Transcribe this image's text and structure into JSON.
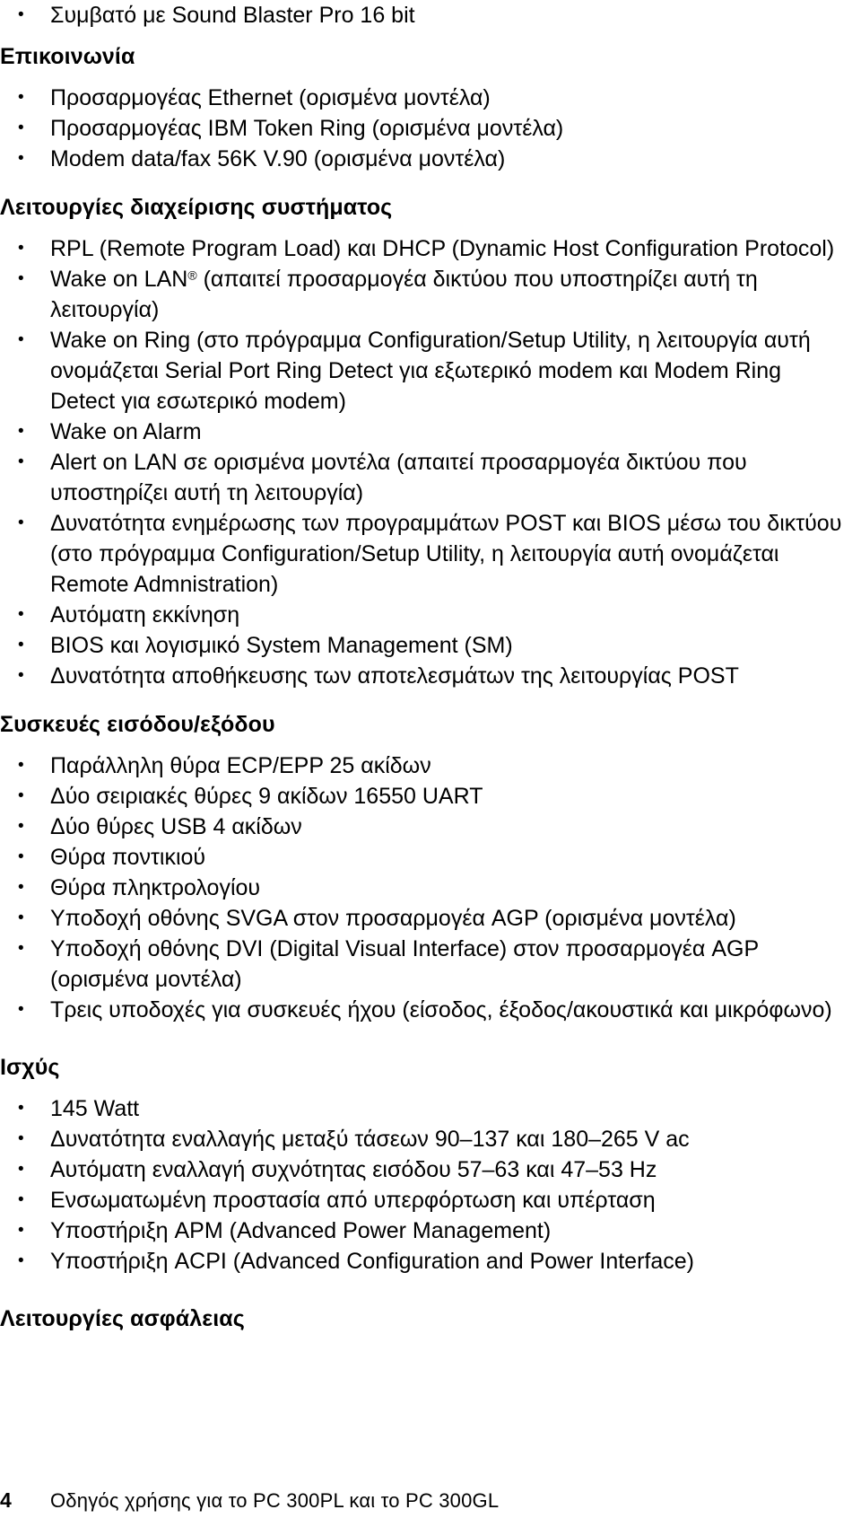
{
  "document": {
    "language": "el",
    "page_number": "4",
    "footer_text": "Οδηγός χρήσης για το PC 300PL και το PC 300GL"
  },
  "top_orphan_bullet": "Συμβατό με Sound Blaster Pro 16 bit",
  "sections": [
    {
      "id": "communications",
      "heading": "Επικοινωνία",
      "bullets": [
        "Προσαρμογέας Ethernet (ορισμένα μοντέλα)",
        "Προσαρμογέας IBM Token Ring (ορισμένα μοντέλα)",
        "Modem data/fax 56K V.90 (ορισμένα μοντέλα)"
      ]
    },
    {
      "id": "system-management",
      "heading": "Λειτουργίες διαχείρισης συστήματος",
      "bullets": [
        "RPL (Remote Program Load) και DHCP (Dynamic Host Configuration Protocol)",
        "Wake on LAN® (απαιτεί προσαρμογέα δικτύου που υποστηρίζει αυτή τη λειτουργία)",
        "Wake on Ring (στο πρόγραμμα Configuration/Setup Utility, η λειτουργία αυτή ονομάζεται Serial Port Ring Detect για εξωτερικό modem και Modem Ring Detect για εσωτερικό modem)",
        "Wake on Alarm",
        "Alert on LAN σε ορισμένα μοντέλα (απαιτεί προσαρμογέα δικτύου που υποστηρίζει αυτή τη λειτουργία)",
        "Δυνατότητα ενημέρωσης των προγραμμάτων POST και BIOS μέσω του δικτύου (στο πρόγραμμα Configuration/Setup Utility, η λειτουργία αυτή ονομάζεται Remote Admnistration)",
        "Αυτόματη εκκίνηση",
        "BIOS και λογισμικό System Management (SM)",
        "Δυνατότητα αποθήκευσης των αποτελεσμάτων της λειτουργίας POST"
      ]
    },
    {
      "id": "io-devices",
      "heading": "Συσκευές εισόδου/εξόδου",
      "bullets": [
        "Παράλληλη θύρα ECP/EPP 25 ακίδων",
        "Δύο σειριακές θύρες 9 ακίδων 16550 UART",
        "Δύο θύρες USB 4 ακίδων",
        "Θύρα ποντικιού",
        "Θύρα πληκτρολογίου",
        "Υποδοχή οθόνης SVGA στον προσαρμογέα AGP (ορισμένα μοντέλα)",
        "Υποδοχή οθόνης DVI (Digital Visual Interface) στον προσαρμογέα AGP (ορισμένα μοντέλα)",
        "Τρεις υποδοχές για συσκευές ήχου (είσοδος, έξοδος/ακουστικά και μικρόφωνο)"
      ]
    },
    {
      "id": "power",
      "heading": "Ισχύς",
      "bullets": [
        "145 Watt",
        "Δυνατότητα εναλλαγής μεταξύ τάσεων 90–137 και 180–265 V ac",
        "Αυτόματη εναλλαγή συχνότητας εισόδου 57–63 και 47–53 Hz",
        "Ενσωματωμένη προστασία από υπερφόρτωση και υπέρταση",
        "Υποστήριξη APM (Advanced Power Management)",
        "Υποστήριξη ACPI (Advanced Configuration and Power Interface)"
      ]
    },
    {
      "id": "security",
      "heading": "Λειτουργίες ασφάλειας",
      "bullets": []
    }
  ]
}
